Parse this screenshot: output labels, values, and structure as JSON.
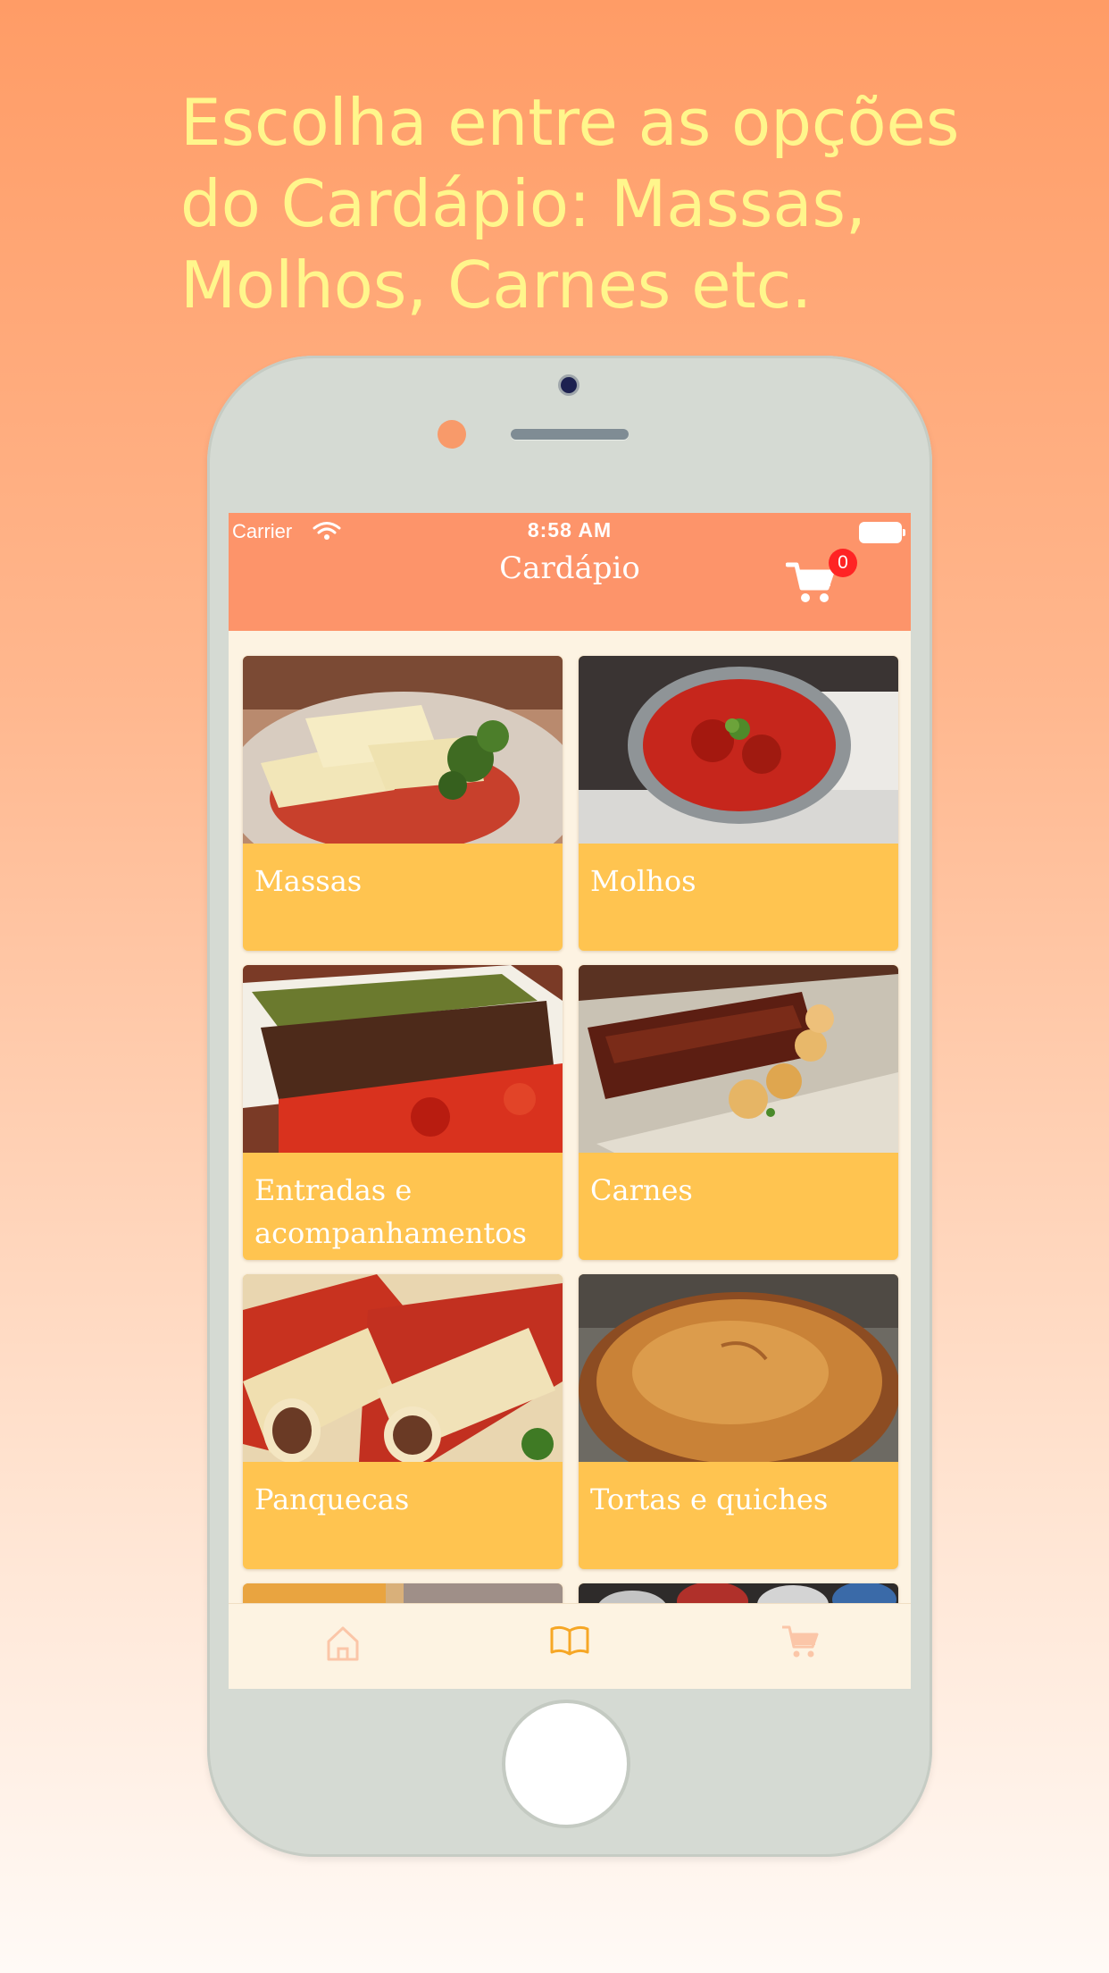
{
  "headline": "Escolha entre as opções do Cardápio: Massas, Molhos, Carnes etc.",
  "status_bar": {
    "carrier": "Carrier",
    "time": "8:58 AM"
  },
  "nav": {
    "title": "Cardápio",
    "cart_count": "0"
  },
  "categories": [
    {
      "label": "Massas",
      "image": "pasta-with-tomato-sauce"
    },
    {
      "label": "Molhos",
      "image": "tomato-sauce-bowl"
    },
    {
      "label": "Entradas e acompanhamentos",
      "image": "appetizers-platter"
    },
    {
      "label": "Carnes",
      "image": "grilled-ribs-with-potatoes"
    },
    {
      "label": "Panquecas",
      "image": "stuffed-crepes"
    },
    {
      "label": "Tortas e quiches",
      "image": "baked-pie"
    }
  ],
  "tabbar": [
    "home-icon",
    "menu-book-icon",
    "cart-icon"
  ],
  "colors": {
    "navbar": "#fd946a",
    "card": "#ffc450",
    "screen_bg": "#fdf3e2",
    "headline": "#fff68c",
    "badge": "#ff2424",
    "tab_active": "#f6a726",
    "tab_inactive": "#fbc6a8"
  }
}
